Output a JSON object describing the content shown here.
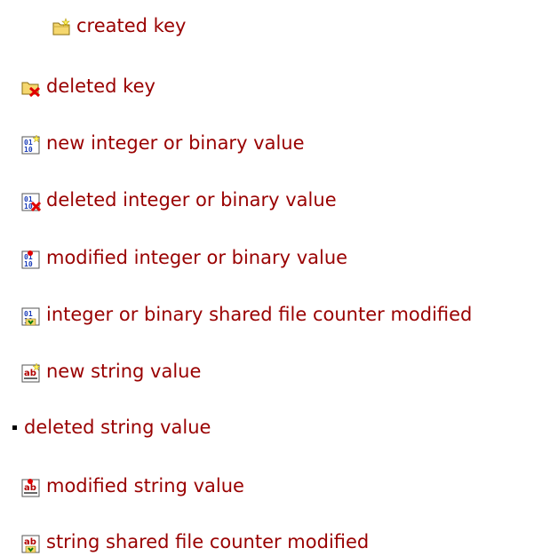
{
  "legend": {
    "items": [
      {
        "label": "created key",
        "icon": "created-key-icon"
      },
      {
        "label": "deleted key",
        "icon": "deleted-key-icon"
      },
      {
        "label": "new integer or binary value",
        "icon": "new-binary-value-icon"
      },
      {
        "label": "deleted integer or binary value",
        "icon": "deleted-binary-value-icon"
      },
      {
        "label": "modified integer or binary value",
        "icon": "modified-binary-value-icon"
      },
      {
        "label": "integer or binary shared file counter modified",
        "icon": "binary-shared-counter-icon"
      },
      {
        "label": "new string value",
        "icon": "new-string-value-icon"
      },
      {
        "label": "deleted string value",
        "icon": "bullet-icon"
      },
      {
        "label": "modified string value",
        "icon": "modified-string-value-icon"
      },
      {
        "label": "string shared file counter modified",
        "icon": "string-shared-counter-icon"
      }
    ]
  },
  "colors": {
    "link_text": "#990000",
    "folder": "#f5d76e",
    "delete_mark": "#e00000",
    "binary_blue": "#1a3cb8"
  }
}
